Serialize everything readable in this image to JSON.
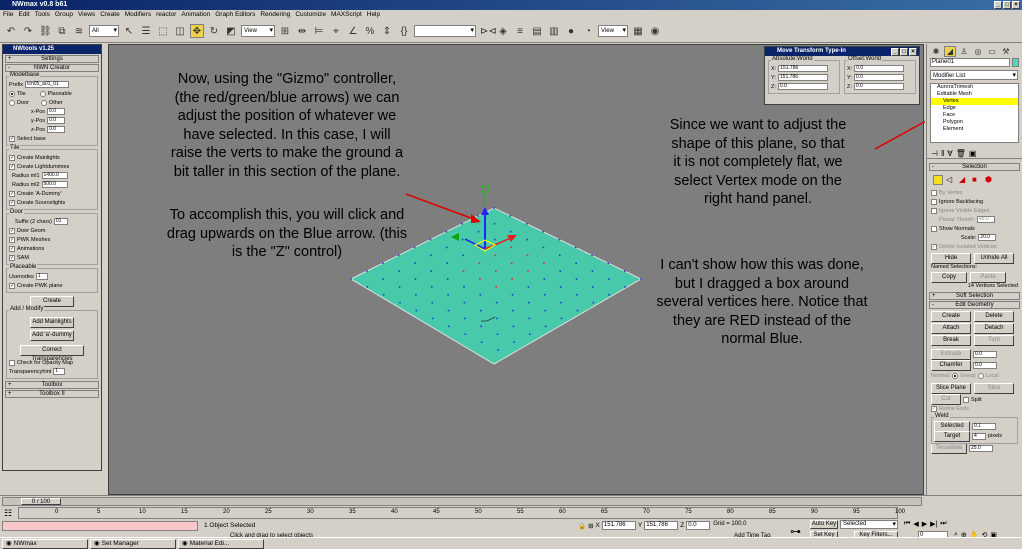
{
  "app": {
    "title": "NWmax v0.8 b61"
  },
  "menu": [
    "File",
    "Edit",
    "Tools",
    "Group",
    "Views",
    "Create",
    "Modifiers",
    "reactor",
    "Animation",
    "Graph Editors",
    "Rendering",
    "Customize",
    "MAXScript",
    "Help"
  ],
  "toolbar": {
    "selection_filter": "All",
    "ref_coord": "View",
    "named_sel": "",
    "view2": "View"
  },
  "left_panel": {
    "title": "NWtools v1.25",
    "settings": "Settings",
    "nwn_creator": "NWN Creator",
    "modelbase": {
      "label": "Modelbase",
      "prefix_label": "Prefix",
      "prefix_value": "tcn05_a01_01",
      "tile": "Tile",
      "placeable": "Placeable",
      "door": "Door",
      "other": "Other",
      "xpos": "x-Pos",
      "ypos": "y-Pos",
      "zpos": "z-Pos",
      "xval": "0.0",
      "yval": "0.0",
      "zval": "0.0",
      "select_base": "Select base"
    },
    "tile": {
      "label": "Tile",
      "mainlights": "Create Mainlights",
      "lightdummies": "Create Lightdummies",
      "radius1_label": "Radius ml1",
      "radius1": "1400.0",
      "radius2_label": "Radius ml2",
      "radius2": "500.0",
      "adummy": "Create 'A-Dummy'",
      "sourcelights": "Create Sourcelights"
    },
    "door": {
      "label": "Door",
      "suffix_label": "Suffix (2 chars)",
      "suffix": "01",
      "geom": "Door Geom",
      "pwk": "PWK Meshes",
      "anim": "Animations",
      "sam": "SAM"
    },
    "placeable": {
      "label": "Placeable",
      "usenodes_label": "Usenodes",
      "usenodes": "1",
      "pwk_plane": "Create PWK plane"
    },
    "create": "Create",
    "add_modify": {
      "label": "Add / Modify",
      "mainlights": "Add Mainlights",
      "adummy": "Add 'a'-dummy",
      "transp": "Correct Transparencies",
      "opacity": "Check for Opacity Map",
      "transp_label": "Transparencyhint",
      "transp_value": "1"
    },
    "toolbox": "Toolbox",
    "toolbox2": "Toolbox II"
  },
  "move_dialog": {
    "title": "Move Transform Type-In",
    "abs": "Absolute:World",
    "offset": "Offset:World",
    "x": "151.786",
    "y": "151.786",
    "z": "0.0",
    "ox": "0.0",
    "oy": "0.0",
    "oz": "0.0"
  },
  "annotations": {
    "a1": [
      "Now, using the \"Gizmo\" controller,",
      "(the red/green/blue arrows) we can",
      "adjust the position of whatever we",
      "have selected.  In this case, I will",
      "raise the verts to make the ground a",
      "bit taller in this section of the plane."
    ],
    "a2": [
      "To accomplish this, you will click and",
      "drag upwards on the Blue arrow. (this",
      "is the \"Z\" control)"
    ],
    "a3": [
      "Since we want to adjust the",
      "shape of this plane, so that",
      "it is not completely flat, we",
      "select Vertex mode on the",
      "right hand panel."
    ],
    "a4": [
      "I can't show how this was done,",
      "but I dragged a box around",
      "several vertices here.  Notice that",
      "they are RED instead of the",
      "normal Blue."
    ]
  },
  "right_panel": {
    "object_name": "Plane01",
    "modifier_list": "Modifier List",
    "stack": [
      "AuroraTrimesh",
      "Editable Mesh",
      "Vertex",
      "Edge",
      "Face",
      "Polygon",
      "Element"
    ],
    "selection": "Selection",
    "by_vertex": "By Vertex",
    "ignore_backfacing": "Ignore Backfacing",
    "ignore_visible_edges": "Ignore Visible Edges",
    "planar_thresh_label": "Planar Thresh:",
    "planar_thresh": "45.0",
    "show_normals": "Show Normals",
    "scale_label": "Scale:",
    "scale": "20.0",
    "delete_isolated": "Delete Isolated Vertices",
    "hide": "Hide",
    "unhide_all": "Unhide All",
    "named_selections": "Named Selections:",
    "copy": "Copy",
    "paste": "Paste",
    "selected_count": "14 Vertices Selected",
    "soft_selection": "Soft Selection",
    "edit_geometry": "Edit Geometry",
    "create": "Create",
    "delete": "Delete",
    "attach": "Attach",
    "detach": "Detach",
    "break": "Break",
    "turn": "Turn",
    "extrude": "Extrude",
    "extrude_val": "0.0",
    "chamfer": "Chamfer",
    "chamfer_val": "0.0",
    "normal_label": "Normal:",
    "group": "Group",
    "local": "Local",
    "slice_plane": "Slice Plane",
    "slice": "Slice",
    "cut": "Cut",
    "split": "Split",
    "refine_ends": "Refine Ends",
    "weld": "Weld",
    "weld_selected": "Selected",
    "weld_sel_val": "0.1",
    "target": "Target",
    "target_val": "4",
    "pixels": "pixels",
    "tessellate": "Tessellate",
    "tess_val": "25.0"
  },
  "timeline": {
    "slider": "0 / 100",
    "ticks": [
      "0",
      "5",
      "10",
      "15",
      "20",
      "25",
      "30",
      "35",
      "40",
      "45",
      "50",
      "55",
      "60",
      "65",
      "70",
      "75",
      "80",
      "85",
      "90",
      "95",
      "100"
    ]
  },
  "status": {
    "selected": "1 Object Selected",
    "prompt": "Click and drag to select objects",
    "x_label": "X",
    "x": "151.786",
    "y_label": "Y",
    "y": "151.786",
    "z_label": "Z",
    "z": "0.0",
    "grid": "Grid = 100.0",
    "add_time_tag": "Add Time Tag",
    "auto_key": "Auto Key",
    "set_key": "Set Key",
    "selected_dd": "Selected",
    "key_filters": "Key Filters...",
    "frame": "0"
  },
  "taskbar": [
    "NWmax",
    "Set Manager",
    "Material Edi..."
  ]
}
